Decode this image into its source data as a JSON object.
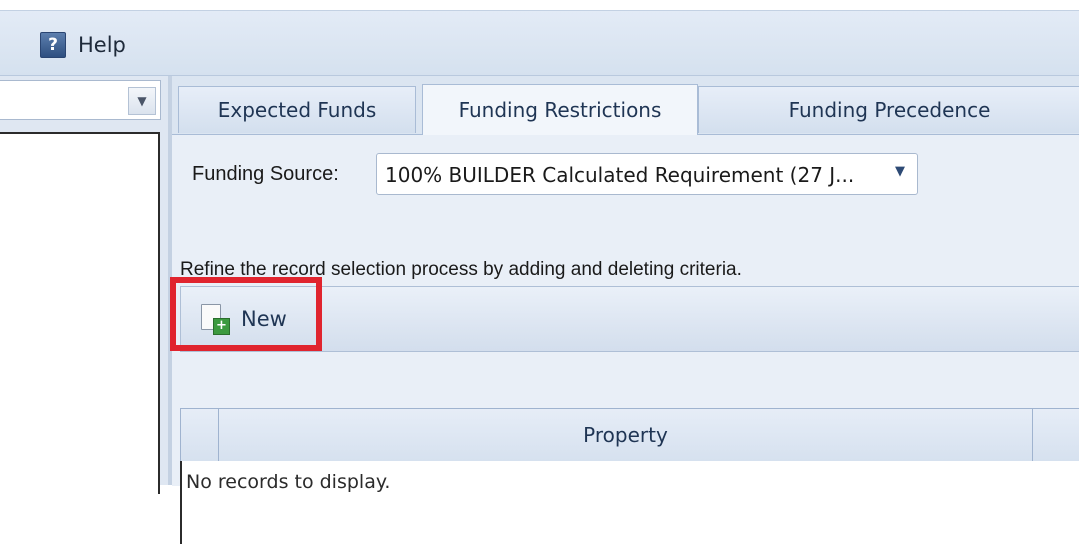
{
  "menu": {
    "help_label": "Help",
    "help_icon": "help-question-icon"
  },
  "left_pane": {
    "combo_value": ""
  },
  "tabs": [
    {
      "label": "Expected Funds"
    },
    {
      "label": "Funding Restrictions",
      "selected": true
    },
    {
      "label": "Funding Precedence"
    }
  ],
  "funding_source": {
    "label": "Funding Source:",
    "value": "100% BUILDER Calculated Requirement (27 J..."
  },
  "refine_text": "Refine the record selection process by adding and deleting criteria.",
  "toolbar": {
    "new_label": "New",
    "new_icon": "new-document-icon"
  },
  "grid": {
    "columns": [
      "Property"
    ],
    "empty_text": "No records to display."
  },
  "colors": {
    "highlight": "#e0242e",
    "accent": "#1f3554"
  }
}
